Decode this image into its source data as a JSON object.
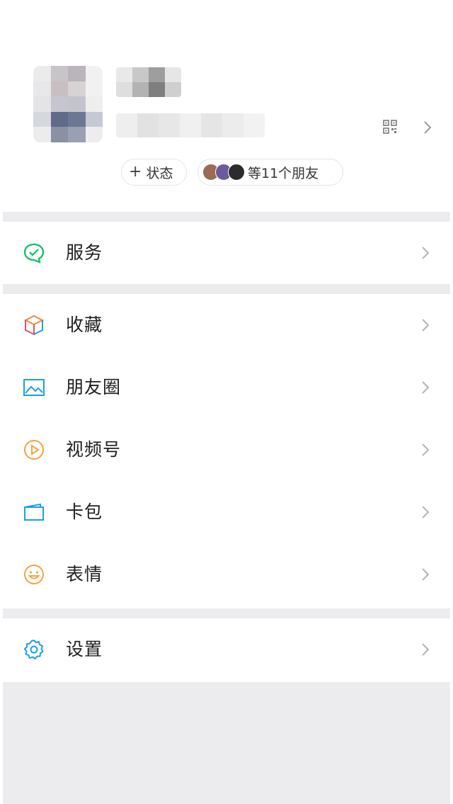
{
  "profile": {
    "status_label": "状态",
    "friends_label": "等11个朋友"
  },
  "menu": {
    "service": {
      "label": "服务",
      "icon": "service-icon"
    },
    "favorites": {
      "label": "收藏",
      "icon": "favorites-cube-icon"
    },
    "moments": {
      "label": "朋友圈",
      "icon": "moments-image-icon"
    },
    "channels": {
      "label": "视频号",
      "icon": "channels-play-icon"
    },
    "cards": {
      "label": "卡包",
      "icon": "card-wallet-icon"
    },
    "stickers": {
      "label": "表情",
      "icon": "smiley-icon"
    },
    "settings": {
      "label": "设置",
      "icon": "gear-icon"
    }
  },
  "colors": {
    "background": "#ffffff",
    "separator": "#ececef",
    "service_green": "#07c160",
    "blue": "#1aa0e8",
    "orange": "#f4a340",
    "text": "#1e1e1e",
    "chevron": "#b5b5b5"
  }
}
